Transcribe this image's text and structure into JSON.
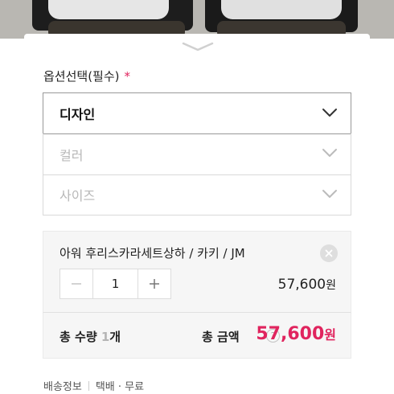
{
  "option_section": {
    "title": "옵션선택(필수)",
    "required_mark": "*"
  },
  "selects": [
    {
      "value": "디자인"
    },
    {
      "placeholder": "컬러"
    },
    {
      "placeholder": "사이즈"
    }
  ],
  "selected_item": {
    "name": "아워 후리스카라세트상하 / 카키 / JM",
    "quantity": "1",
    "price": "57,600",
    "currency": "원"
  },
  "total": {
    "qty_label": "총 수량",
    "qty_value": "1",
    "qty_unit": "개",
    "amount_label": "총 금액",
    "help": "?",
    "amount": "57,600",
    "currency": "원"
  },
  "shipping": {
    "label": "배송정보",
    "value": "택배 · 무료"
  },
  "colors": {
    "accent": "#e0245e",
    "muted": "#b8b8b8"
  }
}
